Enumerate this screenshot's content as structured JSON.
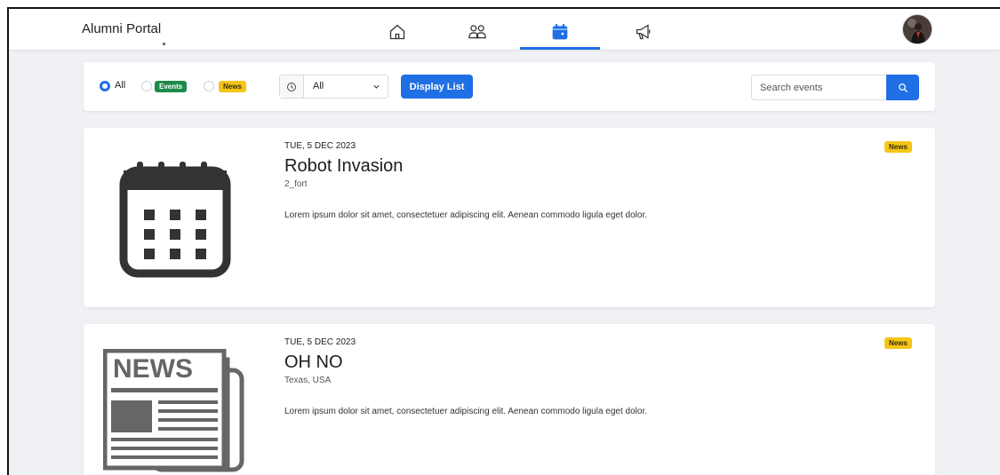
{
  "header": {
    "brand": "Alumni Portal",
    "nav": [
      {
        "icon": "home-icon"
      },
      {
        "icon": "users-icon"
      },
      {
        "icon": "calendar-icon",
        "active": true
      },
      {
        "icon": "megaphone-icon"
      }
    ],
    "avatar": "user-avatar"
  },
  "filters": {
    "type_options": [
      {
        "label": "All",
        "checked": true
      },
      {
        "label": "Events",
        "checked": false
      },
      {
        "label": "News",
        "checked": false
      }
    ],
    "time_select": {
      "value": "All"
    },
    "display_button": "Display List",
    "search": {
      "placeholder": "Search events",
      "value": ""
    }
  },
  "posts": [
    {
      "date": "TUE, 5 DEC 2023",
      "title": "Robot Invasion",
      "location": "2_fort",
      "body": "Lorem ipsum dolor sit amet, consectetuer adipiscing elit. Aenean commodo ligula eget dolor.",
      "badge": "News",
      "image": "calendar-icon"
    },
    {
      "date": "TUE, 5 DEC 2023",
      "title": "OH NO",
      "location": "Texas, USA",
      "body": "Lorem ipsum dolor sit amet, consectetuer adipiscing elit. Aenean commodo ligula eget dolor.",
      "badge": "News",
      "image": "newspaper-icon",
      "image_text": "NEWS"
    }
  ],
  "colors": {
    "primary": "#1f6fe5",
    "events_badge": "#1e8a4a",
    "news_badge": "#f5c518",
    "page_bg": "#f0f1f4"
  }
}
